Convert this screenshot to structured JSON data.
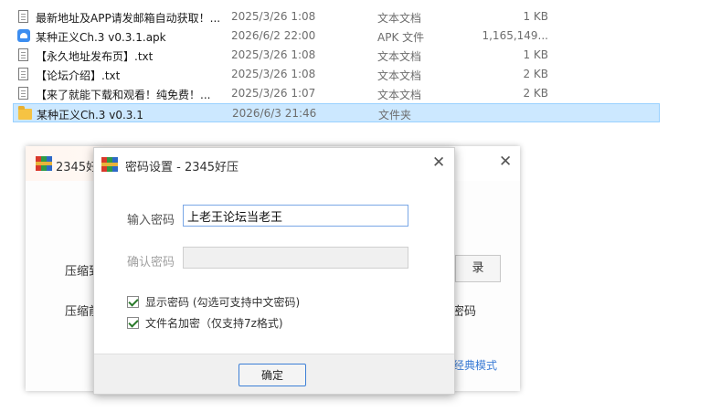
{
  "files": [
    {
      "name": "最新地址及APP请发邮箱自动获取！...",
      "date": "2025/3/26 1:08",
      "type": "文本文档",
      "size": "1 KB",
      "icon": "text-file-icon"
    },
    {
      "name": "某种正义Ch.3 v0.3.1.apk",
      "date": "2026/6/2 22:00",
      "type": "APK 文件",
      "size": "1,165,149...",
      "icon": "apk-file-icon"
    },
    {
      "name": "【永久地址发布页】.txt",
      "date": "2025/3/26 1:08",
      "type": "文本文档",
      "size": "1 KB",
      "icon": "text-file-icon"
    },
    {
      "name": "【论坛介绍】.txt",
      "date": "2025/3/26 1:08",
      "type": "文本文档",
      "size": "2 KB",
      "icon": "text-file-icon"
    },
    {
      "name": "【来了就能下载和观看！纯免费！...",
      "date": "2025/3/26 1:07",
      "type": "文本文档",
      "size": "2 KB",
      "icon": "text-file-icon"
    },
    {
      "name": "某种正义Ch.3 v0.3.1",
      "date": "2026/6/3 21:46",
      "type": "文件夹",
      "size": "",
      "icon": "folder-icon"
    }
  ],
  "bg_window": {
    "title": "2345好",
    "label1": "压缩到",
    "label2": "压缩前",
    "button": "录",
    "right_text": "密码",
    "link": "经典模式"
  },
  "dialog": {
    "title": "密码设置 - 2345好压",
    "password_label": "输入密码",
    "password_value": "上老王论坛当老王",
    "confirm_label": "确认密码",
    "confirm_value": "",
    "show_password": "显示密码 (勾选可支持中文密码)",
    "encrypt_names": "文件名加密（仅支持7z格式)",
    "ok": "确定"
  }
}
